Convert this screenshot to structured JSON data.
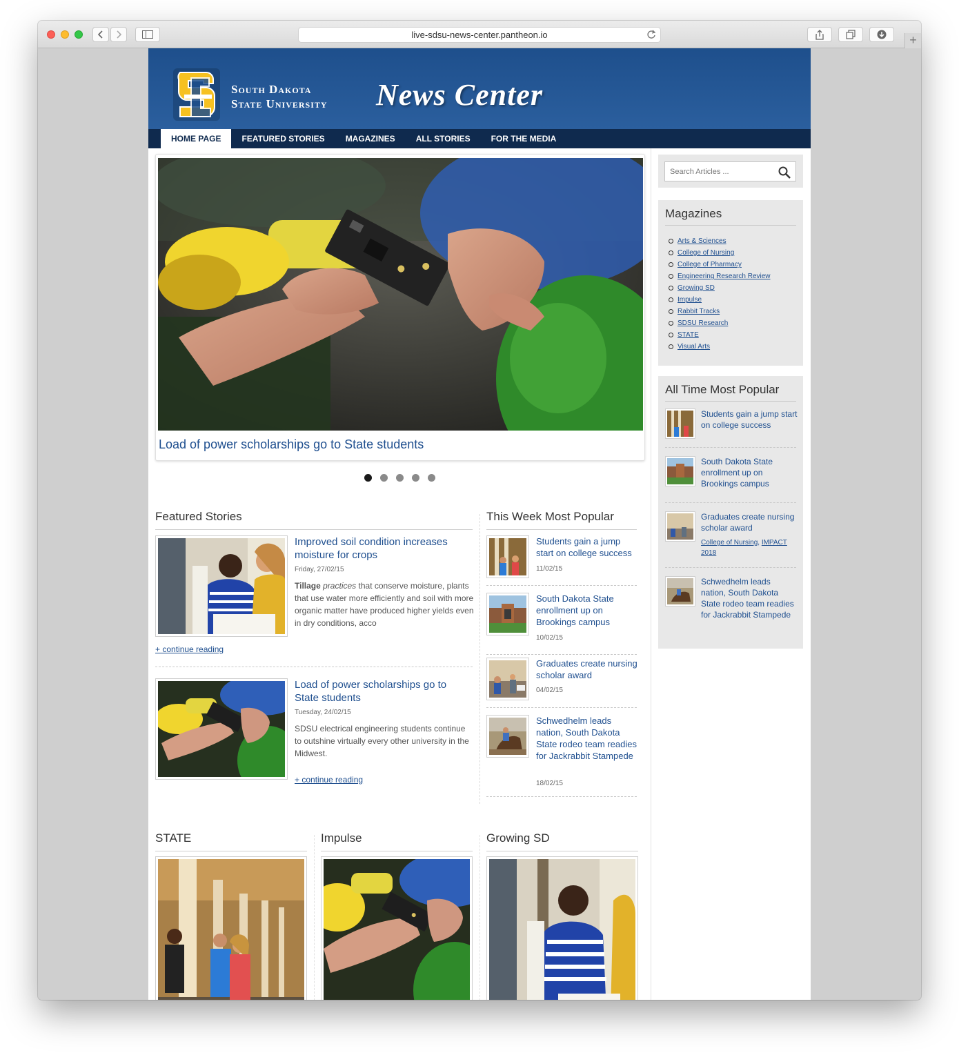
{
  "browser": {
    "url": "live-sdsu-news-center.pantheon.io"
  },
  "site": {
    "university_line1": "South Dakota",
    "university_line2": "State University",
    "title": "News Center",
    "colors": {
      "primary": "#1e4f8c",
      "nav": "#0f2a4e",
      "link": "#1f4f8f"
    }
  },
  "nav": {
    "items": [
      {
        "label": "HOME PAGE",
        "active": true
      },
      {
        "label": "FEATURED STORIES"
      },
      {
        "label": "MAGAZINES"
      },
      {
        "label": "ALL STORIES"
      },
      {
        "label": "FOR THE MEDIA"
      }
    ]
  },
  "slider": {
    "caption": "Load of power scholarships go to State students",
    "slide_count": 5,
    "active_index": 0
  },
  "featured": {
    "heading": "Featured Stories",
    "continue_label": "+ continue reading",
    "items": [
      {
        "title": "Improved soil condition increases moisture for crops",
        "date": "Friday, 27/02/15",
        "excerpt_lead": "Tillage",
        "excerpt_em": "practices",
        "excerpt_rest": "that conserve moisture, plants that use water more efficiently and soil with more organic matter have produced higher yields even in dry conditions, acco"
      },
      {
        "title": "Load of power scholarships go to State students",
        "date": "Tuesday, 24/02/15",
        "excerpt": "SDSU electrical engineering students continue to outshine virtually every other university in the Midwest."
      }
    ]
  },
  "week_popular": {
    "heading": "This Week Most Popular",
    "items": [
      {
        "title": "Students gain a jump start on college success",
        "date": "11/02/15"
      },
      {
        "title": "South Dakota State enrollment up on Brookings campus",
        "date": "10/02/15"
      },
      {
        "title": "Graduates create nursing scholar award",
        "date": "04/02/15"
      },
      {
        "title": "Schwedhelm leads nation, South Dakota State rodeo team readies for Jackrabbit Stampede",
        "date": "18/02/15"
      }
    ]
  },
  "magazine_columns": [
    {
      "heading": "STATE"
    },
    {
      "heading": "Impulse"
    },
    {
      "heading": "Growing SD"
    }
  ],
  "sidebar": {
    "search_placeholder": "Search Articles ...",
    "magazines_heading": "Magazines",
    "magazines": [
      "Arts & Sciences",
      "College of Nursing",
      "College of Pharmacy",
      "Engineering Research Review",
      "Growing SD",
      "Impulse",
      "Rabbit Tracks",
      "SDSU Research",
      "STATE",
      "Visual Arts"
    ],
    "popular_heading": "All Time Most Popular",
    "popular": [
      {
        "title": "Students gain a jump start on college success"
      },
      {
        "title": "South Dakota State enrollment up on Brookings campus"
      },
      {
        "title": "Graduates create nursing scholar award",
        "tag1": "College of Nursing",
        "tag_sep": ", ",
        "tag2": "IMPACT 2018"
      },
      {
        "title": "Schwedhelm leads nation, South Dakota State rodeo team readies for Jackrabbit Stampede"
      }
    ]
  }
}
